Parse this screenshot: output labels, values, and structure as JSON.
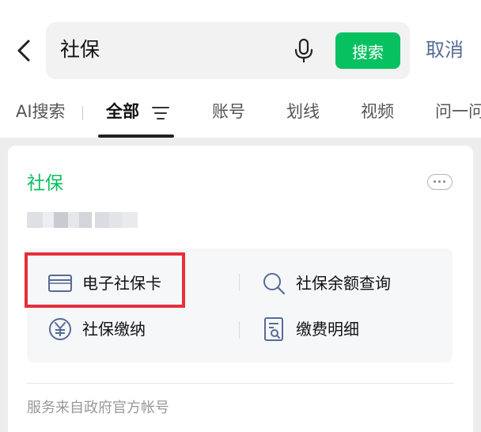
{
  "search": {
    "query": "社保",
    "submit_label": "搜索",
    "cancel_label": "取消"
  },
  "tabs": [
    {
      "label": "AI搜索",
      "active": false
    },
    {
      "label": "全部",
      "active": true
    },
    {
      "label": "账号",
      "active": false
    },
    {
      "label": "划线",
      "active": false
    },
    {
      "label": "视频",
      "active": false
    },
    {
      "label": "问一问",
      "active": false
    }
  ],
  "card": {
    "title": "社保",
    "services": [
      {
        "label": "电子社保卡",
        "icon": "card-icon"
      },
      {
        "label": "社保余额查询",
        "icon": "search-icon"
      },
      {
        "label": "社保缴纳",
        "icon": "yuan-icon"
      },
      {
        "label": "缴费明细",
        "icon": "document-search-icon"
      }
    ],
    "footer": "服务来自政府官方帐号"
  },
  "colors": {
    "brand_green": "#07c160",
    "link_blue": "#576b95",
    "highlight_red": "#e5303a"
  }
}
